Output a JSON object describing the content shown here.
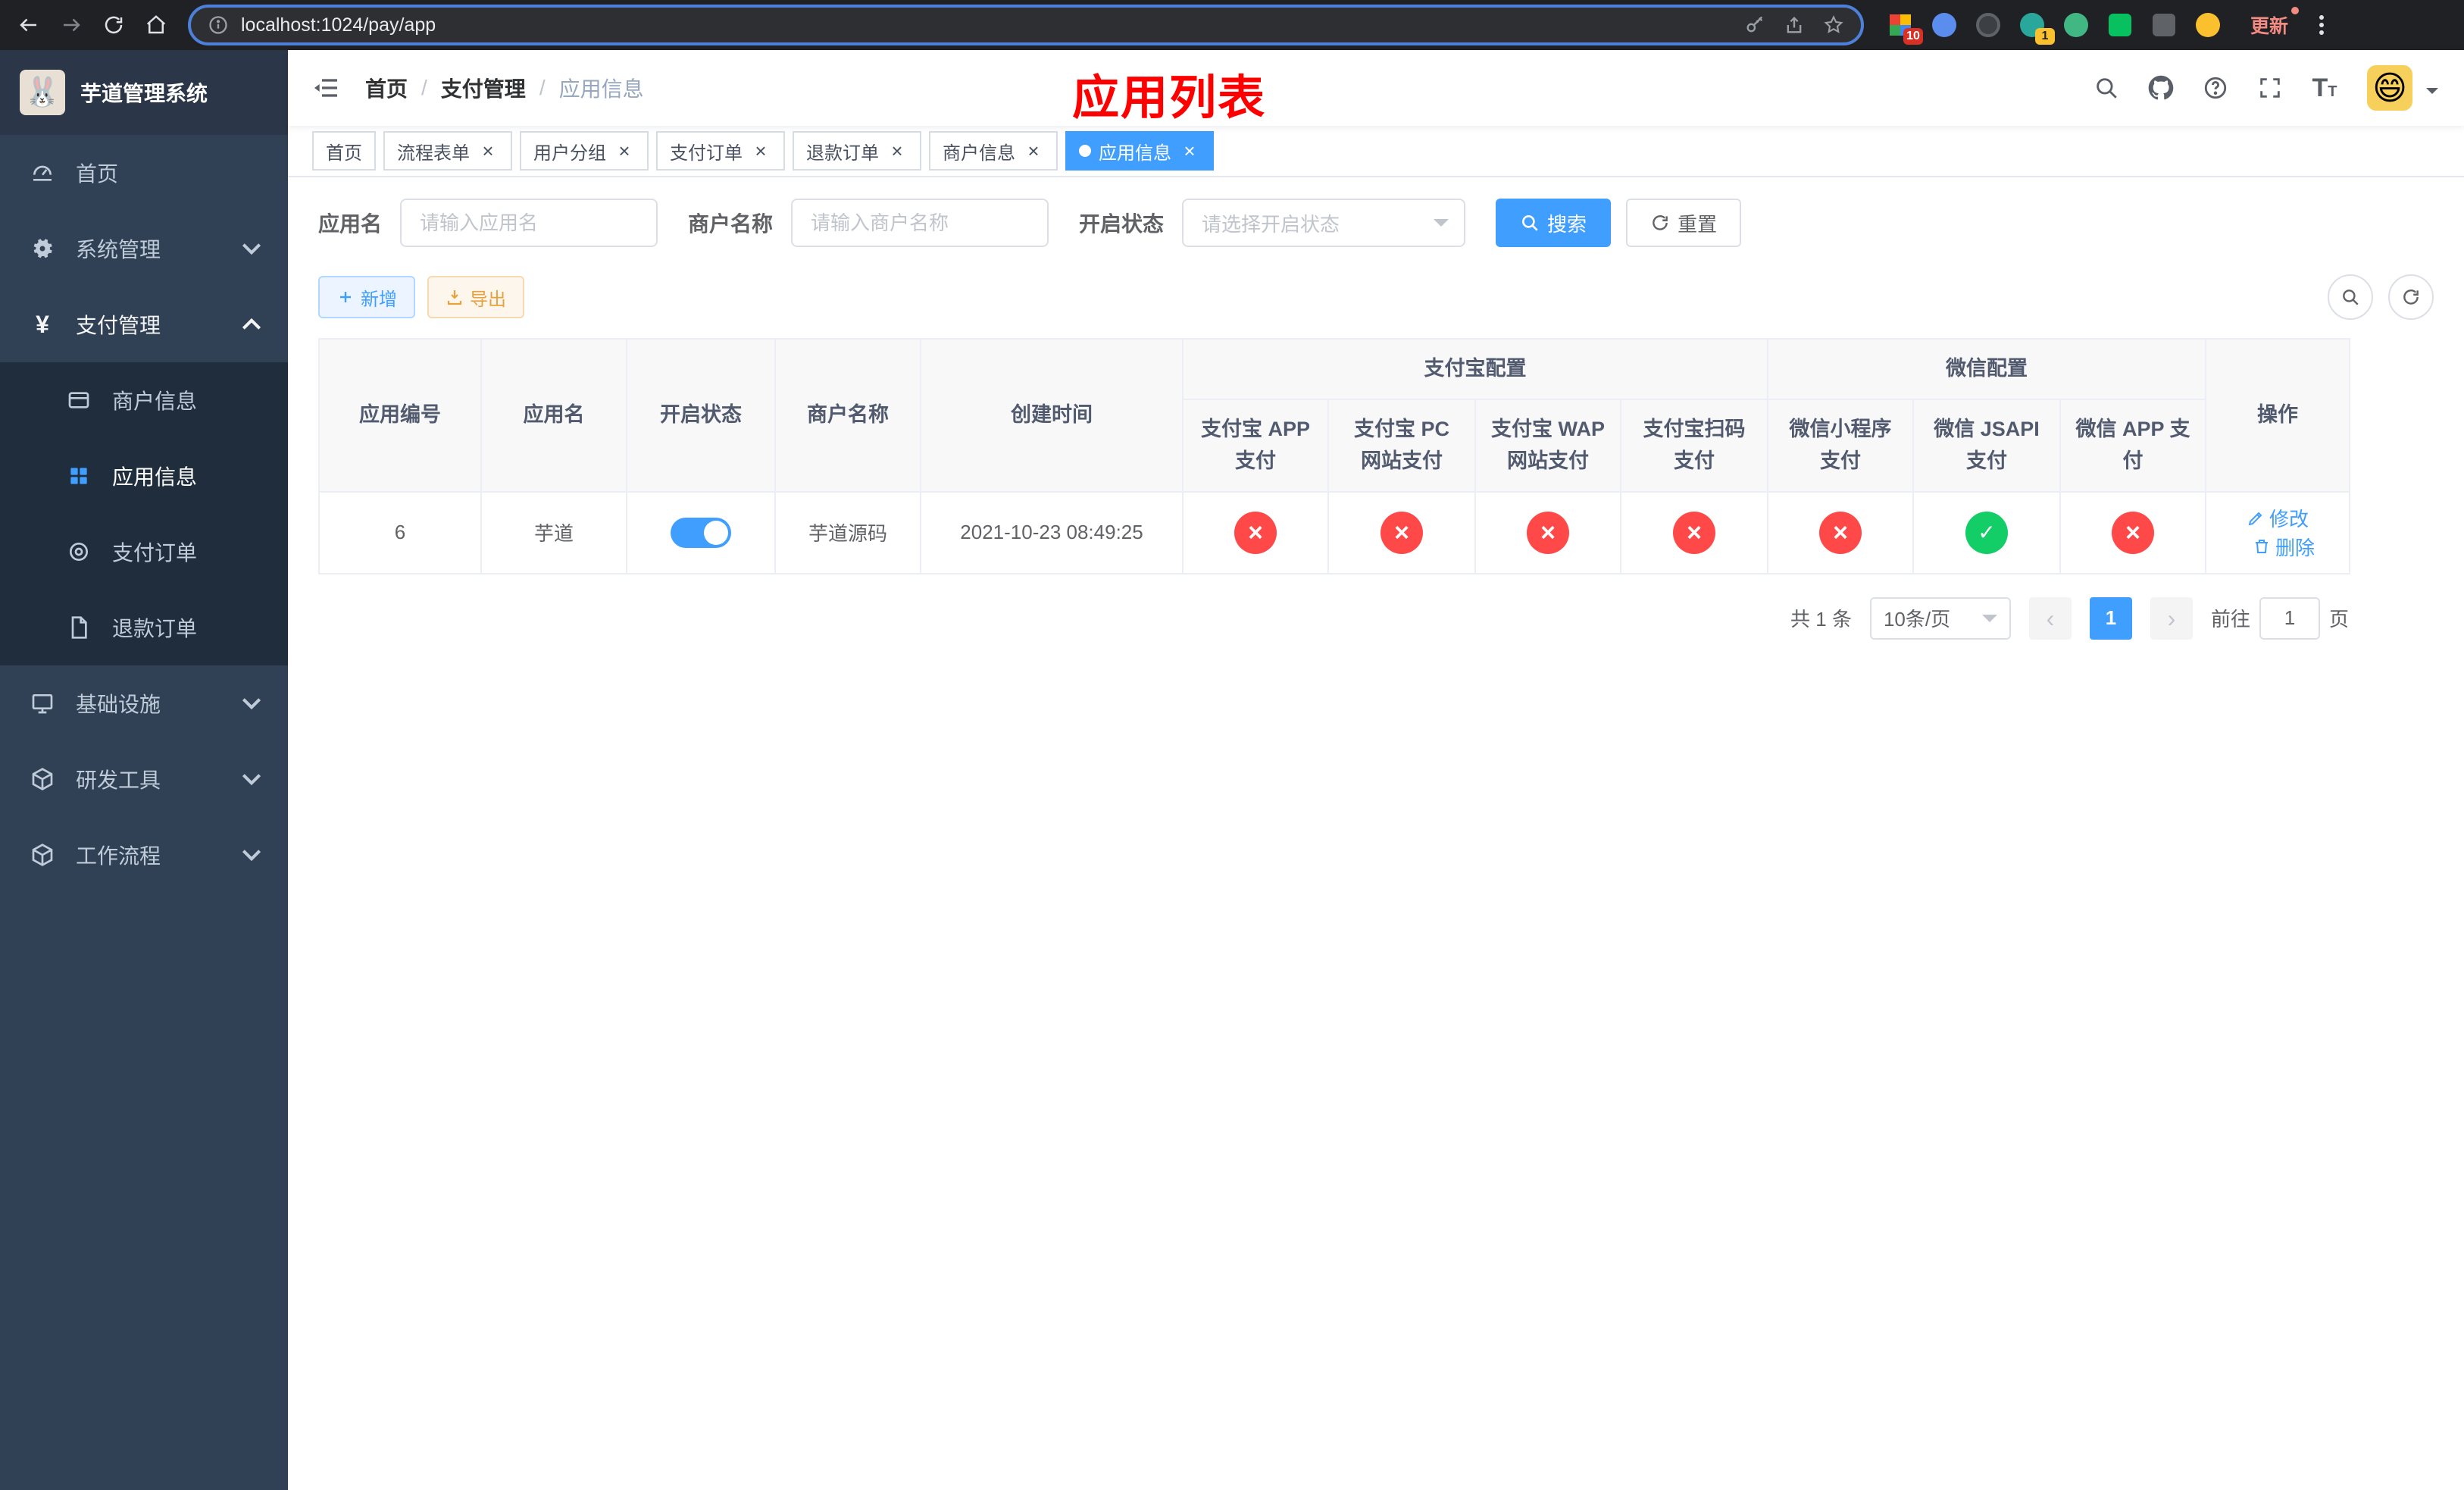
{
  "browser": {
    "url": "localhost:1024/pay/app",
    "update_label": "更新",
    "ext_badge_grid": "10",
    "ext_badge_avatar": "1"
  },
  "sidebar": {
    "title": "芋道管理系统",
    "logo_emoji": "🐰",
    "menu": [
      {
        "label": "首页"
      },
      {
        "label": "系统管理"
      },
      {
        "label": "支付管理"
      },
      {
        "label": "基础设施"
      },
      {
        "label": "研发工具"
      },
      {
        "label": "工作流程"
      }
    ],
    "submenu": [
      {
        "label": "商户信息"
      },
      {
        "label": "应用信息"
      },
      {
        "label": "支付订单"
      },
      {
        "label": "退款订单"
      }
    ]
  },
  "navbar": {
    "breadcrumb": [
      "首页",
      "支付管理",
      "应用信息"
    ],
    "annotation": "应用列表",
    "avatar_emoji": "😄"
  },
  "tags": [
    {
      "label": "首页"
    },
    {
      "label": "流程表单"
    },
    {
      "label": "用户分组"
    },
    {
      "label": "支付订单"
    },
    {
      "label": "退款订单"
    },
    {
      "label": "商户信息"
    },
    {
      "label": "应用信息"
    }
  ],
  "filters": {
    "app_name": {
      "label": "应用名",
      "placeholder": "请输入应用名",
      "value": ""
    },
    "merchant_name": {
      "label": "商户名称",
      "placeholder": "请输入商户名称",
      "value": ""
    },
    "status": {
      "label": "开启状态",
      "placeholder": "请选择开启状态"
    },
    "search_label": "搜索",
    "reset_label": "重置"
  },
  "toolbar": {
    "add_label": "新增",
    "export_label": "导出"
  },
  "table": {
    "headers": {
      "app_id": "应用编号",
      "app_name": "应用名",
      "status": "开启状态",
      "merchant_name": "商户名称",
      "created_at": "创建时间",
      "alipay_group": "支付宝配置",
      "wechat_group": "微信配置",
      "actions": "操作",
      "alipay_cols": [
        "支付宝 APP 支付",
        "支付宝 PC 网站支付",
        "支付宝 WAP 网站支付",
        "支付宝扫码支付"
      ],
      "wechat_cols": [
        "微信小程序支付",
        "微信 JSAPI 支付",
        "微信 APP 支付"
      ]
    },
    "rows": [
      {
        "app_id": "6",
        "app_name": "芋道",
        "status_on": true,
        "merchant_name": "芋道源码",
        "created_at": "2021-10-23 08:49:25",
        "alipay": [
          "error",
          "error",
          "error",
          "error"
        ],
        "wechat": [
          "error",
          "ok",
          "error"
        ],
        "edit_label": "修改",
        "delete_label": "删除"
      }
    ]
  },
  "pagination": {
    "total_text": "共 1 条",
    "page_size": "10条/页",
    "current_page": "1",
    "jump_prefix": "前往",
    "jump_value": "1",
    "jump_suffix": "页"
  },
  "colors": {
    "primary": "#409eff",
    "danger": "#ff4949",
    "success": "#13ce66",
    "sidebar_bg": "#304156",
    "submenu_bg": "#1f2d3d",
    "annotation_red": "#ff0000"
  }
}
